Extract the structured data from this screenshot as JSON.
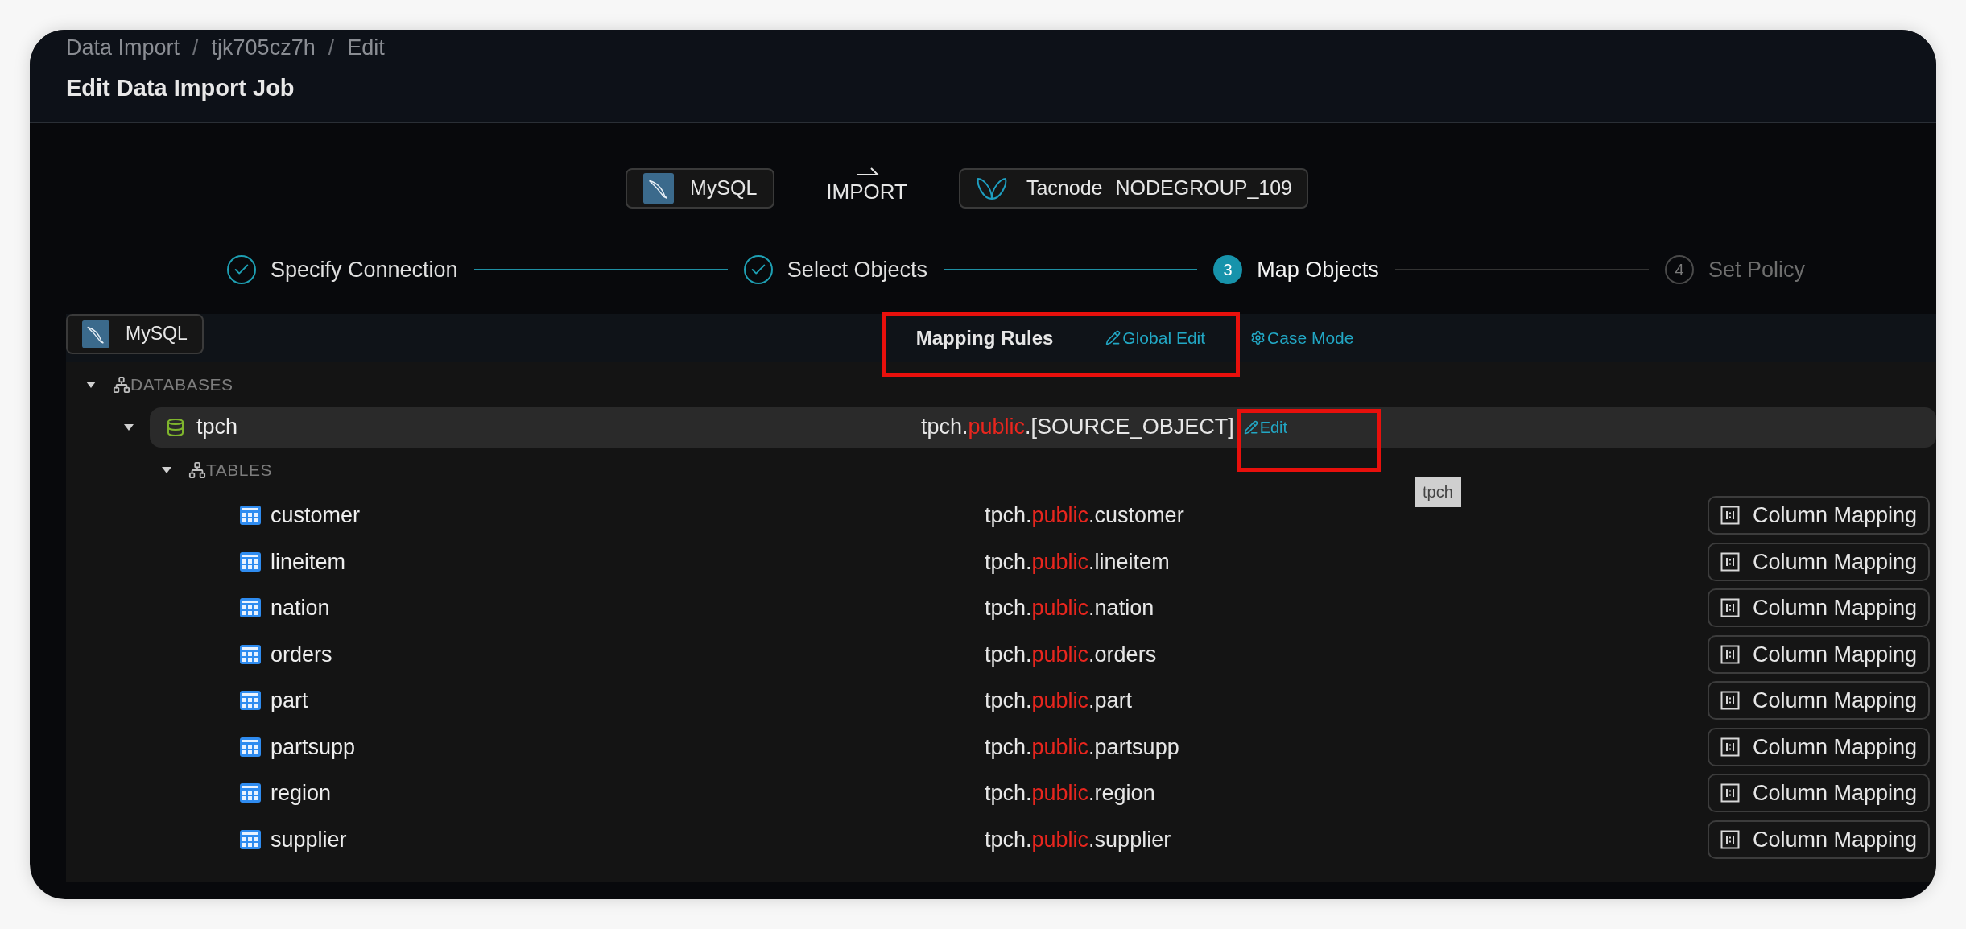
{
  "breadcrumb": [
    {
      "kind": "crumb",
      "label": "Data Import"
    },
    {
      "kind": "separator",
      "label": "/"
    },
    {
      "kind": "crumb",
      "label": "tjk705cz7h"
    },
    {
      "kind": "separator",
      "label": "/"
    },
    {
      "kind": "crumb",
      "label": "Edit"
    }
  ],
  "title": "Edit Data Import Job",
  "source": {
    "label": "MySQL"
  },
  "import_label": "IMPORT",
  "target": {
    "name": "Tacnode",
    "group": "NODEGROUP_109"
  },
  "steps": [
    {
      "label": "Specify Connection",
      "done": true,
      "selected": false
    },
    {
      "label": "Select Objects",
      "done": true,
      "selected": false
    },
    {
      "number": "3",
      "label": "Map Objects",
      "done": false,
      "selected": true
    },
    {
      "number": "4",
      "label": "Set Policy",
      "done": false,
      "selected": false
    }
  ],
  "panel": {
    "source_label": "MySQL",
    "title": "Mapping Rules",
    "actions": [
      {
        "kind": "edit",
        "label": "Global Edit"
      },
      {
        "kind": "settings",
        "label": "Case Mode"
      }
    ]
  },
  "tree": [
    {
      "kind": "group",
      "label": "DATABASES",
      "expanded": true,
      "children": [
        {
          "kind": "database",
          "label": "tpch",
          "expanded": true,
          "highlighted": true,
          "target": {
            "prefix": "tpch.",
            "schema": "public",
            "suffix": ".[SOURCE_OBJECT]"
          },
          "action": "Edit",
          "children": [
            {
              "kind": "group",
              "label": "TABLES",
              "expanded": true,
              "children": [
                {
                  "kind": "table",
                  "label": "customer",
                  "target": {
                    "prefix": "tpch.",
                    "schema": "public",
                    "suffix": ".customer"
                  },
                  "action": "Column Mapping"
                },
                {
                  "kind": "table",
                  "label": "lineitem",
                  "target": {
                    "prefix": "tpch.",
                    "schema": "public",
                    "suffix": ".lineitem"
                  },
                  "action": "Column Mapping"
                },
                {
                  "kind": "table",
                  "label": "nation",
                  "target": {
                    "prefix": "tpch.",
                    "schema": "public",
                    "suffix": ".nation"
                  },
                  "action": "Column Mapping"
                },
                {
                  "kind": "table",
                  "label": "orders",
                  "target": {
                    "prefix": "tpch.",
                    "schema": "public",
                    "suffix": ".orders"
                  },
                  "action": "Column Mapping"
                },
                {
                  "kind": "table",
                  "label": "part",
                  "target": {
                    "prefix": "tpch.",
                    "schema": "public",
                    "suffix": ".part"
                  },
                  "action": "Column Mapping"
                },
                {
                  "kind": "table",
                  "label": "partsupp",
                  "target": {
                    "prefix": "tpch.",
                    "schema": "public",
                    "suffix": ".partsupp"
                  },
                  "action": "Column Mapping"
                },
                {
                  "kind": "table",
                  "label": "region",
                  "target": {
                    "prefix": "tpch.",
                    "schema": "public",
                    "suffix": ".region"
                  },
                  "action": "Column Mapping"
                },
                {
                  "kind": "table",
                  "label": "supplier",
                  "target": {
                    "prefix": "tpch.",
                    "schema": "public",
                    "suffix": ".supplier"
                  },
                  "action": "Column Mapping"
                }
              ]
            }
          ]
        }
      ]
    }
  ],
  "tooltip": "tpch"
}
